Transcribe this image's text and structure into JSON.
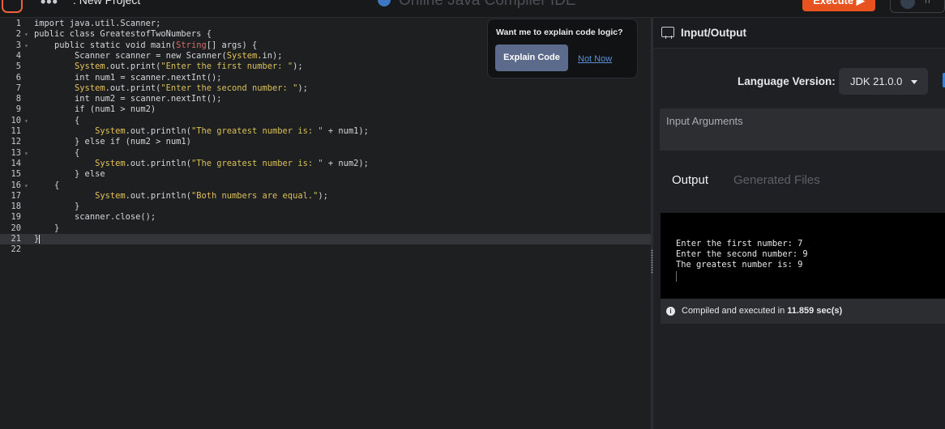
{
  "topbar": {
    "menu_dots": "•••",
    "project_name": ": New Project",
    "app_title": "Online Java Compiler IDE",
    "execute_label": "Execute ▶",
    "user_initial": "n"
  },
  "editor": {
    "lines": [
      {
        "num": "1",
        "fold": "",
        "segments": [
          {
            "t": "import java.util.Scanner;",
            "c": "kw"
          }
        ]
      },
      {
        "num": "2",
        "fold": "▾",
        "segments": [
          {
            "t": "public class GreatestofTwoNumbers {",
            "c": "kw"
          }
        ]
      },
      {
        "num": "3",
        "fold": "▾",
        "segments": [
          {
            "t": "    public static void main(",
            "c": "kw"
          },
          {
            "t": "String",
            "c": "strng"
          },
          {
            "t": "[] args) {",
            "c": "kw"
          }
        ]
      },
      {
        "num": "4",
        "fold": "",
        "segments": [
          {
            "t": "        Scanner scanner = new Scanner(",
            "c": "kw"
          },
          {
            "t": "System",
            "c": "sys"
          },
          {
            "t": ".in);",
            "c": "kw"
          }
        ]
      },
      {
        "num": "5",
        "fold": "",
        "segments": [
          {
            "t": "        ",
            "c": "kw"
          },
          {
            "t": "System",
            "c": "sys"
          },
          {
            "t": ".out.print(",
            "c": "kw"
          },
          {
            "t": "\"Enter the first number: \"",
            "c": "str"
          },
          {
            "t": ");",
            "c": "kw"
          }
        ]
      },
      {
        "num": "6",
        "fold": "",
        "segments": [
          {
            "t": "        int num1 = scanner.nextInt();",
            "c": "kw"
          }
        ]
      },
      {
        "num": "7",
        "fold": "",
        "segments": [
          {
            "t": "        ",
            "c": "kw"
          },
          {
            "t": "System",
            "c": "sys"
          },
          {
            "t": ".out.print(",
            "c": "kw"
          },
          {
            "t": "\"Enter the second number: \"",
            "c": "str"
          },
          {
            "t": ");",
            "c": "kw"
          }
        ]
      },
      {
        "num": "8",
        "fold": "",
        "segments": [
          {
            "t": "        int num2 = scanner.nextInt();",
            "c": "kw"
          }
        ]
      },
      {
        "num": "9",
        "fold": "",
        "segments": [
          {
            "t": "        if (num1 > num2)",
            "c": "kw"
          }
        ]
      },
      {
        "num": "10",
        "fold": "▾",
        "segments": [
          {
            "t": "        {",
            "c": "kw"
          }
        ]
      },
      {
        "num": "11",
        "fold": "",
        "segments": [
          {
            "t": "            ",
            "c": "kw"
          },
          {
            "t": "System",
            "c": "sys"
          },
          {
            "t": ".out.println(",
            "c": "kw"
          },
          {
            "t": "\"The greatest number is: \"",
            "c": "str"
          },
          {
            "t": " + num1);",
            "c": "kw"
          }
        ]
      },
      {
        "num": "12",
        "fold": "",
        "segments": [
          {
            "t": "        } else if (num2 > num1)",
            "c": "kw"
          }
        ]
      },
      {
        "num": "13",
        "fold": "▾",
        "segments": [
          {
            "t": "        {",
            "c": "kw"
          }
        ]
      },
      {
        "num": "14",
        "fold": "",
        "segments": [
          {
            "t": "            ",
            "c": "kw"
          },
          {
            "t": "System",
            "c": "sys"
          },
          {
            "t": ".out.println(",
            "c": "kw"
          },
          {
            "t": "\"The greatest number is: \"",
            "c": "str"
          },
          {
            "t": " + num2);",
            "c": "kw"
          }
        ]
      },
      {
        "num": "15",
        "fold": "",
        "segments": [
          {
            "t": "        } else",
            "c": "kw"
          }
        ]
      },
      {
        "num": "16",
        "fold": "▾",
        "segments": [
          {
            "t": "    {",
            "c": "kw"
          }
        ]
      },
      {
        "num": "17",
        "fold": "",
        "segments": [
          {
            "t": "            ",
            "c": "kw"
          },
          {
            "t": "System",
            "c": "sys"
          },
          {
            "t": ".out.println(",
            "c": "kw"
          },
          {
            "t": "\"Both numbers are equal.\"",
            "c": "str"
          },
          {
            "t": ");",
            "c": "kw"
          }
        ]
      },
      {
        "num": "18",
        "fold": "",
        "segments": [
          {
            "t": "        }",
            "c": "kw"
          }
        ]
      },
      {
        "num": "19",
        "fold": "",
        "segments": [
          {
            "t": "        scanner.close();",
            "c": "kw"
          }
        ]
      },
      {
        "num": "20",
        "fold": "",
        "segments": [
          {
            "t": "    }",
            "c": "kw"
          }
        ]
      },
      {
        "num": "21",
        "fold": "",
        "segments": [
          {
            "t": "}",
            "c": "kw"
          }
        ],
        "active": true
      },
      {
        "num": "22",
        "fold": "",
        "segments": []
      }
    ]
  },
  "popup": {
    "question": "Want me to explain code logic?",
    "explain_label": "Explain Code",
    "not_now_label": "Not Now"
  },
  "panel": {
    "header_label": "Input/Output",
    "language_label": "Language Version:",
    "language_value": "JDK 21.0.0",
    "args_placeholder": "Input Arguments",
    "tab_output": "Output",
    "tab_files": "Generated Files",
    "output_lines": [
      "Enter the first number: 7",
      "Enter the second number: 9",
      "The greatest number is: 9"
    ],
    "status_prefix": "Compiled and executed in ",
    "status_time": "11.859 sec(s)"
  },
  "colors": {
    "execute": "#e8521f",
    "explain_button": "#5c6b8c",
    "link": "#5b8fd6",
    "string_literal": "#d9c05a",
    "system_class": "#e6c35b",
    "string_type": "#d86a6a"
  }
}
